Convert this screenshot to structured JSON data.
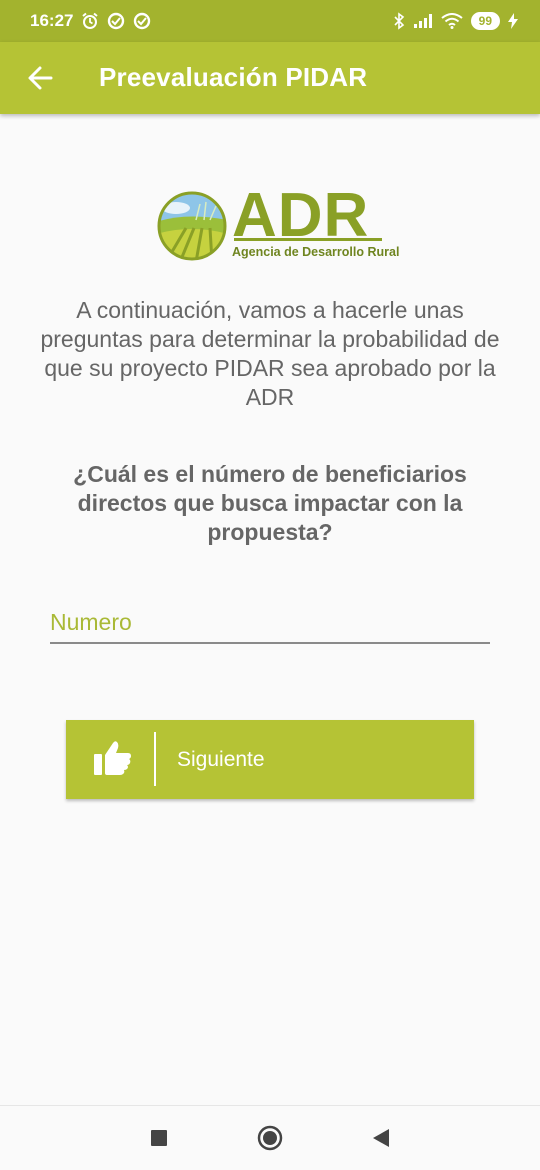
{
  "status_bar": {
    "time": "16:27",
    "left_icons": [
      "alarm-icon",
      "data-saver-icon",
      "data-saver-icon"
    ],
    "right_icons": [
      "bluetooth-icon",
      "signal-icon",
      "wifi-icon"
    ],
    "battery": "99",
    "charging_icon": "bolt-icon"
  },
  "app_bar": {
    "title": "Preevaluación PIDAR",
    "back_icon": "arrow-left-icon",
    "color": "#b5c335"
  },
  "logo": {
    "text": "ADR",
    "subtitle": "Agencia de Desarrollo Rural"
  },
  "intro_text": "A continuación, vamos a hacerle unas preguntas para determinar la probabilidad de que su proyecto PIDAR sea aprobado por la ADR",
  "question_text": "¿Cuál es el número de beneficiarios directos que busca impactar con la propuesta?",
  "number_field": {
    "placeholder": "Numero",
    "value": ""
  },
  "next_button": {
    "label": "Siguiente",
    "icon": "thumbs-up-icon"
  },
  "nav_bar": {
    "icons": [
      "recents-square-icon",
      "home-circle-icon",
      "back-triangle-icon"
    ]
  },
  "colors": {
    "accent": "#b5c335",
    "status_bar": "#a3b32e",
    "text": "#666666"
  }
}
